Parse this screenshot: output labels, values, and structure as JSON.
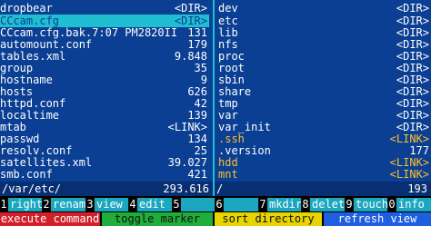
{
  "left_panel": {
    "rows": [
      {
        "name": "dropbear",
        "size": "<DIR>",
        "selected": false,
        "link": false
      },
      {
        "name": "CCcam.cfg",
        "size": "<DIR>",
        "selected": true,
        "link": false
      },
      {
        "name": "CCcam.cfg.bak.7:07 PM2820II",
        "size": "131",
        "selected": false,
        "link": false
      },
      {
        "name": "automount.conf",
        "size": "179",
        "selected": false,
        "link": false
      },
      {
        "name": "tables.xml",
        "size": "9.848",
        "selected": false,
        "link": false
      },
      {
        "name": "group",
        "size": "35",
        "selected": false,
        "link": false
      },
      {
        "name": "hostname",
        "size": "9",
        "selected": false,
        "link": false
      },
      {
        "name": "hosts",
        "size": "626",
        "selected": false,
        "link": false
      },
      {
        "name": "httpd.conf",
        "size": "42",
        "selected": false,
        "link": false
      },
      {
        "name": "localtime",
        "size": "139",
        "selected": false,
        "link": false
      },
      {
        "name": "mtab",
        "size": "<LINK>",
        "selected": false,
        "link": false
      },
      {
        "name": "passwd",
        "size": "134",
        "selected": false,
        "link": false
      },
      {
        "name": "resolv.conf",
        "size": "25",
        "selected": false,
        "link": false
      },
      {
        "name": "satellites.xml",
        "size": "39.027",
        "selected": false,
        "link": false
      },
      {
        "name": "smb.conf",
        "size": "421",
        "selected": false,
        "link": false
      }
    ],
    "path": "/var/etc/",
    "total": "293.616"
  },
  "right_panel": {
    "rows": [
      {
        "name": "dev",
        "size": "<DIR>",
        "link": false
      },
      {
        "name": "etc",
        "size": "<DIR>",
        "link": false
      },
      {
        "name": "lib",
        "size": "<DIR>",
        "link": false
      },
      {
        "name": "nfs",
        "size": "<DIR>",
        "link": false
      },
      {
        "name": "proc",
        "size": "<DIR>",
        "link": false
      },
      {
        "name": "root",
        "size": "<DIR>",
        "link": false
      },
      {
        "name": "sbin",
        "size": "<DIR>",
        "link": false
      },
      {
        "name": "share",
        "size": "<DIR>",
        "link": false
      },
      {
        "name": "tmp",
        "size": "<DIR>",
        "link": false
      },
      {
        "name": "var",
        "size": "<DIR>",
        "link": false
      },
      {
        "name": "var_init",
        "size": "<DIR>",
        "link": false
      },
      {
        "name": ".ssh",
        "size": "<LINK>",
        "link": true
      },
      {
        "name": ".version",
        "size": "177",
        "link": false
      },
      {
        "name": "hdd",
        "size": "<LINK>",
        "link": true
      },
      {
        "name": "mnt",
        "size": "<LINK>",
        "link": true
      }
    ],
    "path": "/",
    "total": "193"
  },
  "function_keys": [
    {
      "num": "1",
      "label": "rights"
    },
    {
      "num": "2",
      "label": "rename"
    },
    {
      "num": "3",
      "label": "view"
    },
    {
      "num": "4",
      "label": "edit"
    },
    {
      "num": "5",
      "label": ""
    },
    {
      "num": "6",
      "label": ""
    },
    {
      "num": "7",
      "label": "mkdir"
    },
    {
      "num": "8",
      "label": "delete"
    },
    {
      "num": "9",
      "label": "touch"
    },
    {
      "num": "0",
      "label": "info"
    }
  ],
  "color_buttons": {
    "red": "execute command",
    "green": "toggle marker",
    "yellow": "sort directory",
    "blue": "refresh view"
  },
  "colors": {
    "panel_bg": "#0a3f93",
    "selection": "#1fbfd1",
    "link_text": "#ffbf2e",
    "red": "#d21f2a",
    "green": "#1fae3a",
    "yellow": "#e8d400",
    "blue": "#1d5fe0"
  }
}
